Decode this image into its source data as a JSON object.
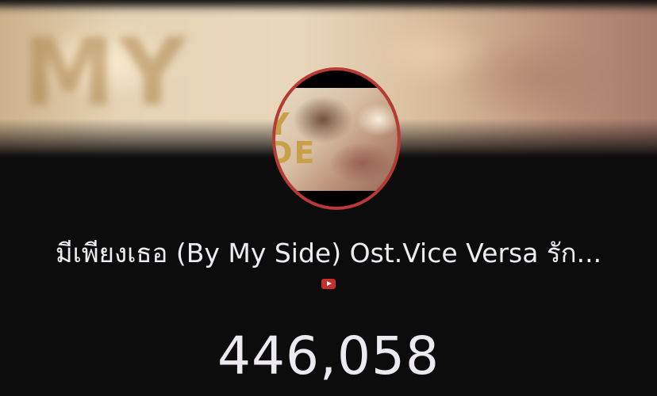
{
  "banner": {
    "art_text": "MY"
  },
  "avatar": {
    "art_text": "Y\nDE",
    "border_color": "#b73a34"
  },
  "video": {
    "title": "มีเพียงเธอ (By My Side) Ost.Vice Versa รัก...",
    "source_icon": "youtube-icon",
    "source_color": "#c4302b"
  },
  "stats": {
    "views": "446,058"
  }
}
